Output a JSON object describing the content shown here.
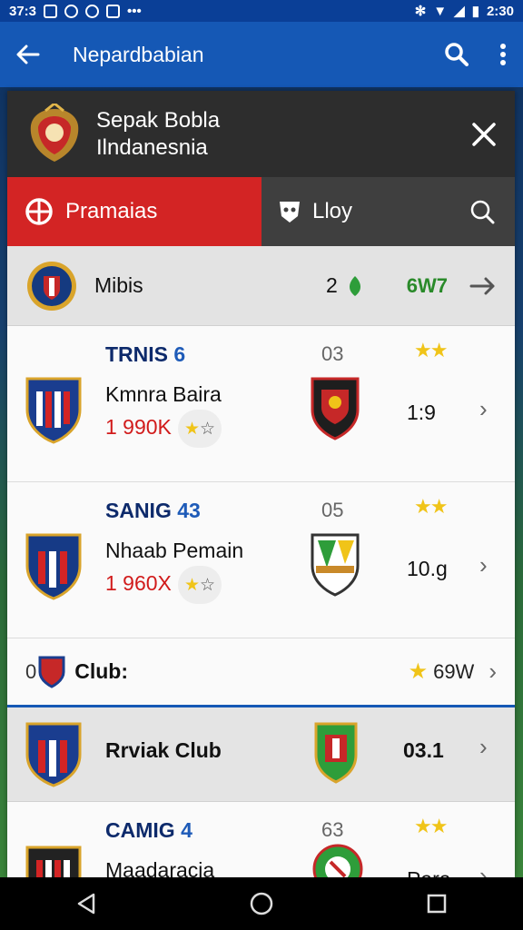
{
  "status": {
    "time_left": "37:3",
    "time_right": "2:30"
  },
  "app_bar": {
    "title": "Nepardbabian"
  },
  "card": {
    "title_line1": "Sepak Bobla",
    "title_line2": "Ilndanesnia"
  },
  "tabs": {
    "active_label": "Pramaias",
    "inactive_label": "Lloy"
  },
  "summary": {
    "label": "Mibis",
    "count": "2",
    "value": "6W7"
  },
  "matches": [
    {
      "code": "TRNIS",
      "code_num": "6",
      "name": "Kmnra Baira",
      "price": "1 990K",
      "num": "03",
      "stars": "★★",
      "score": "1:9"
    },
    {
      "code": "SANIG",
      "code_num": "43",
      "name": "Nhaab Pemain",
      "price": "1 960X",
      "num": "05",
      "stars": "★★",
      "score": "10.g"
    }
  ],
  "club": {
    "prefix": "0",
    "label": "Club:",
    "value": "69W"
  },
  "rival": {
    "name": "Rrviak Club",
    "score": "03.1"
  },
  "match3": {
    "code": "CAMIG",
    "code_num": "4",
    "name": "Maadaracia",
    "num": "63",
    "stars": "★★",
    "score": "Para"
  },
  "colors": {
    "accent_blue": "#1558b5",
    "accent_red": "#d32424",
    "star": "#f0c419"
  }
}
